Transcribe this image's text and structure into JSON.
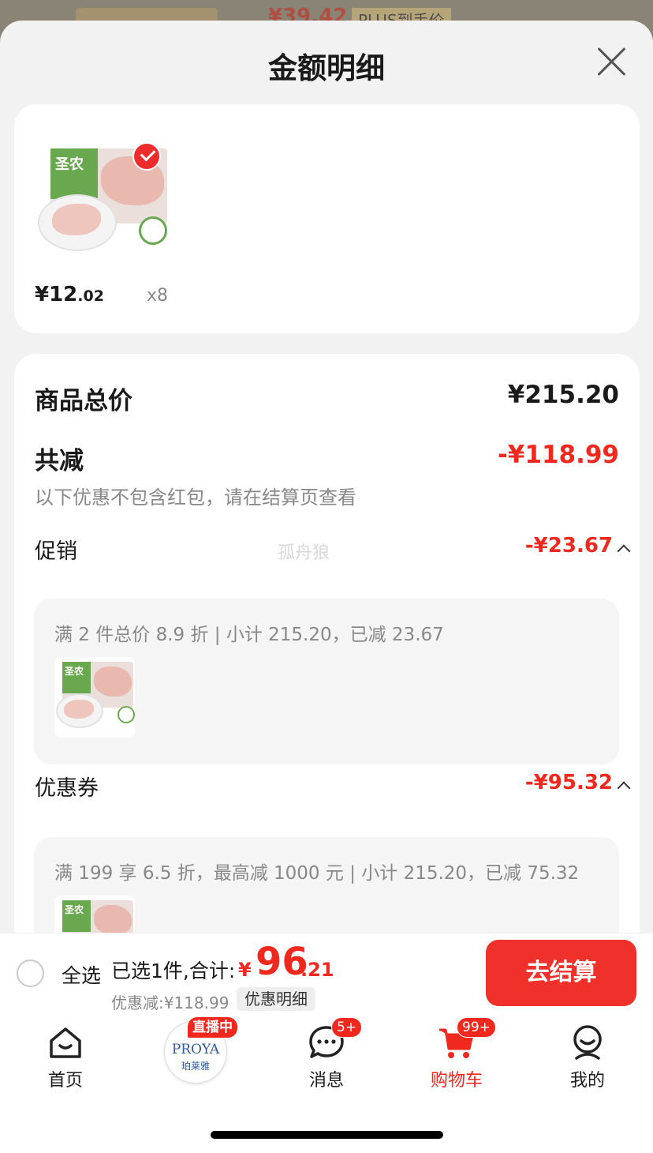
{
  "backdrop": {
    "price_fragment": "¥39.42",
    "plus_badge": "PLUS到手价"
  },
  "sheet": {
    "title": "金额明细"
  },
  "product": {
    "brand_text": "圣农",
    "price_int": "¥12",
    "price_dec": ".02",
    "quantity": "x8",
    "selected": true
  },
  "summary": {
    "total_label": "商品总价",
    "total_value": "¥215.20",
    "reduce_label": "共减",
    "reduce_value": "-¥118.99",
    "reduce_note": "以下优惠不包含红包，请在结算页查看"
  },
  "promotion": {
    "label": "促销",
    "value": "-¥23.67",
    "detail": "满 2 件总价 8.9 折 | 小计 215.20，已减 23.67"
  },
  "coupon": {
    "label": "优惠券",
    "value": "-¥95.32",
    "detail": "满 199 享 6.5 折，最高减 1000 元 | 小计 215.20，已减 75.32"
  },
  "watermark": "孤舟狼",
  "checkout": {
    "select_all": "全选",
    "selected_info": "已选1件,合计:",
    "total_yen": "¥",
    "total_int": "96",
    "total_dec": ".21",
    "discount_line": "优惠减:¥118.99",
    "detail_chip": "优惠明细",
    "checkout_button": "去结算"
  },
  "tabbar": {
    "home": "首页",
    "live_brand": "PROYA",
    "live_sub": "珀莱雅",
    "live_badge": "直播中",
    "messages": "消息",
    "messages_badge": "5+",
    "cart": "购物车",
    "cart_badge": "99+",
    "me": "我的"
  },
  "colors": {
    "accent": "#f0281e",
    "checkout_button": "#f0302a",
    "sheet_bg": "#f2f2f2"
  },
  "icons": [
    "close-icon",
    "check-icon",
    "home-icon",
    "message-icon",
    "cart-icon",
    "user-icon"
  ]
}
